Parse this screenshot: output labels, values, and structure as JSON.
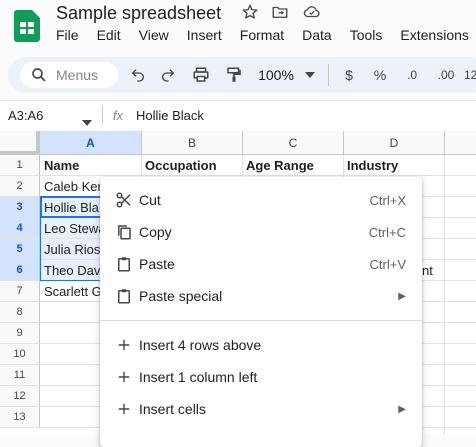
{
  "doc": {
    "title": "Sample spreadsheet"
  },
  "menu": [
    "File",
    "Edit",
    "View",
    "Insert",
    "Format",
    "Data",
    "Tools",
    "Extensions"
  ],
  "toolbar": {
    "search_placeholder": "Menus",
    "zoom": "100%",
    "currency": "$",
    "percent": "%",
    "dec_decrease": ".0",
    "dec_increase": ".00",
    "more_formats": "12"
  },
  "formula_bar": {
    "range": "A3:A6",
    "fx": "fx",
    "value": "Hollie Black"
  },
  "columns": [
    "A",
    "B",
    "C",
    "D"
  ],
  "rows": [
    "1",
    "2",
    "3",
    "4",
    "5",
    "6",
    "7",
    "8",
    "9",
    "10",
    "11",
    "12",
    "13"
  ],
  "cells": {
    "A1": "Name",
    "B1": "Occupation",
    "C1": "Age Range",
    "D1": "Industry",
    "A2": "Caleb Ker",
    "A3": "Hollie Bla",
    "A4": "Leo Stewa",
    "A5": "Julia Rios",
    "A6": "Theo Davi",
    "A7": "Scarlett G",
    "D6": "nt"
  },
  "context_menu": {
    "cut": {
      "label": "Cut",
      "shortcut": "Ctrl+X"
    },
    "copy": {
      "label": "Copy",
      "shortcut": "Ctrl+C"
    },
    "paste": {
      "label": "Paste",
      "shortcut": "Ctrl+V"
    },
    "paste_special": {
      "label": "Paste special"
    },
    "insert_rows": {
      "label": "Insert 4 rows above"
    },
    "insert_column": {
      "label": "Insert 1 column left"
    },
    "insert_cells": {
      "label": "Insert cells"
    }
  },
  "colors": {
    "accent": "#1a73e8",
    "selection": "#d3e3fd",
    "sheets_green": "#0f9d58"
  }
}
